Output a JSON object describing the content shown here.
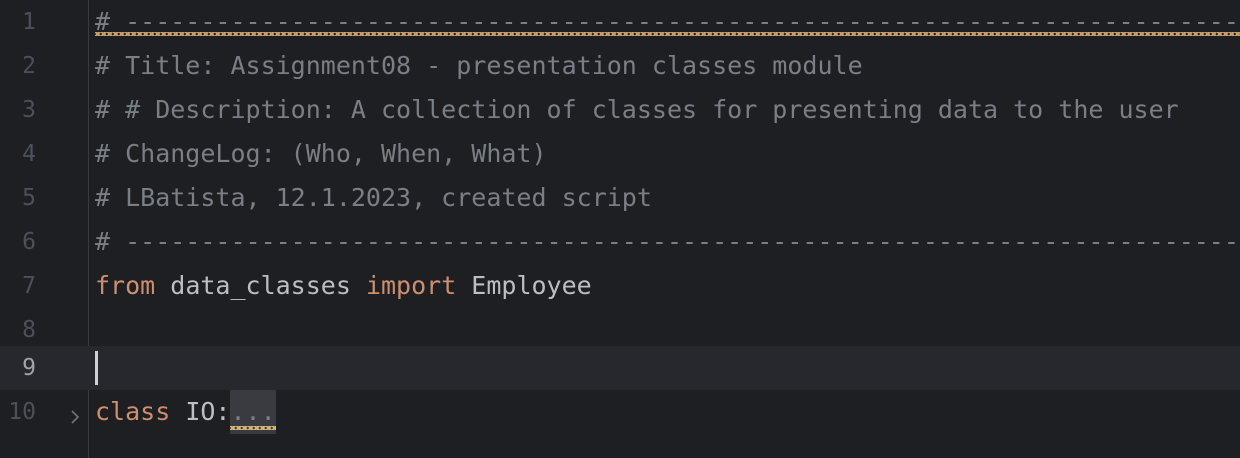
{
  "editor": {
    "current_line": 9,
    "colors": {
      "background": "#1e1f22",
      "current_line_background": "#26282e",
      "comment": "#7a7e85",
      "keyword": "#cf8e6d",
      "identifier": "#bcbec4",
      "line_number": "#4b5059",
      "line_number_current": "#a1a3ab",
      "warning_squiggle": "#d5b778"
    },
    "lines": [
      {
        "number": "1",
        "text": "# ----------------------------------------------------------------------------------------------"
      },
      {
        "number": "2",
        "text": "# Title: Assignment08 - presentation classes module"
      },
      {
        "number": "3",
        "text": "# # Description: A collection of classes for presenting data to the user"
      },
      {
        "number": "4",
        "text": "# ChangeLog: (Who, When, What)"
      },
      {
        "number": "5",
        "text": "# LBatista, 12.1.2023, created script"
      },
      {
        "number": "6",
        "text": "# ----------------------------------------------------------------------------------------------"
      },
      {
        "number": "7",
        "kw1": "from",
        "mod": " data_classes ",
        "kw2": "import",
        "name": " Employee"
      },
      {
        "number": "8",
        "text": ""
      },
      {
        "number": "9",
        "text": ""
      },
      {
        "number": "10",
        "kw": "class",
        "name": " IO:",
        "folded": "..."
      }
    ],
    "fold_icon": "chevron-right-icon"
  }
}
